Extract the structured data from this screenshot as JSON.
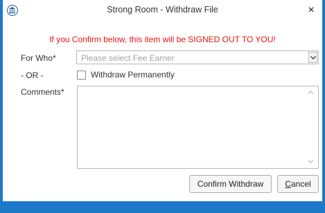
{
  "window": {
    "title": "Strong Room - Withdraw File",
    "close_glyph": "×",
    "icon": "bank-icon",
    "accent_color": "#1e78c8"
  },
  "form": {
    "warning": "If you Confirm below, this item will be SIGNED OUT TO YOU!",
    "warning_color": "#e8140c",
    "for_who_label": "For Who*",
    "for_who_placeholder": "Please select Fee Earner",
    "or_label": "- OR -",
    "withdraw_permanently_label": "Withdraw Permanently",
    "withdraw_permanently_checked": false,
    "comments_label": "Comments*",
    "comments_value": ""
  },
  "buttons": {
    "confirm_label": "Confirm Withdraw",
    "cancel_label_first": "C",
    "cancel_label_rest": "ancel"
  }
}
